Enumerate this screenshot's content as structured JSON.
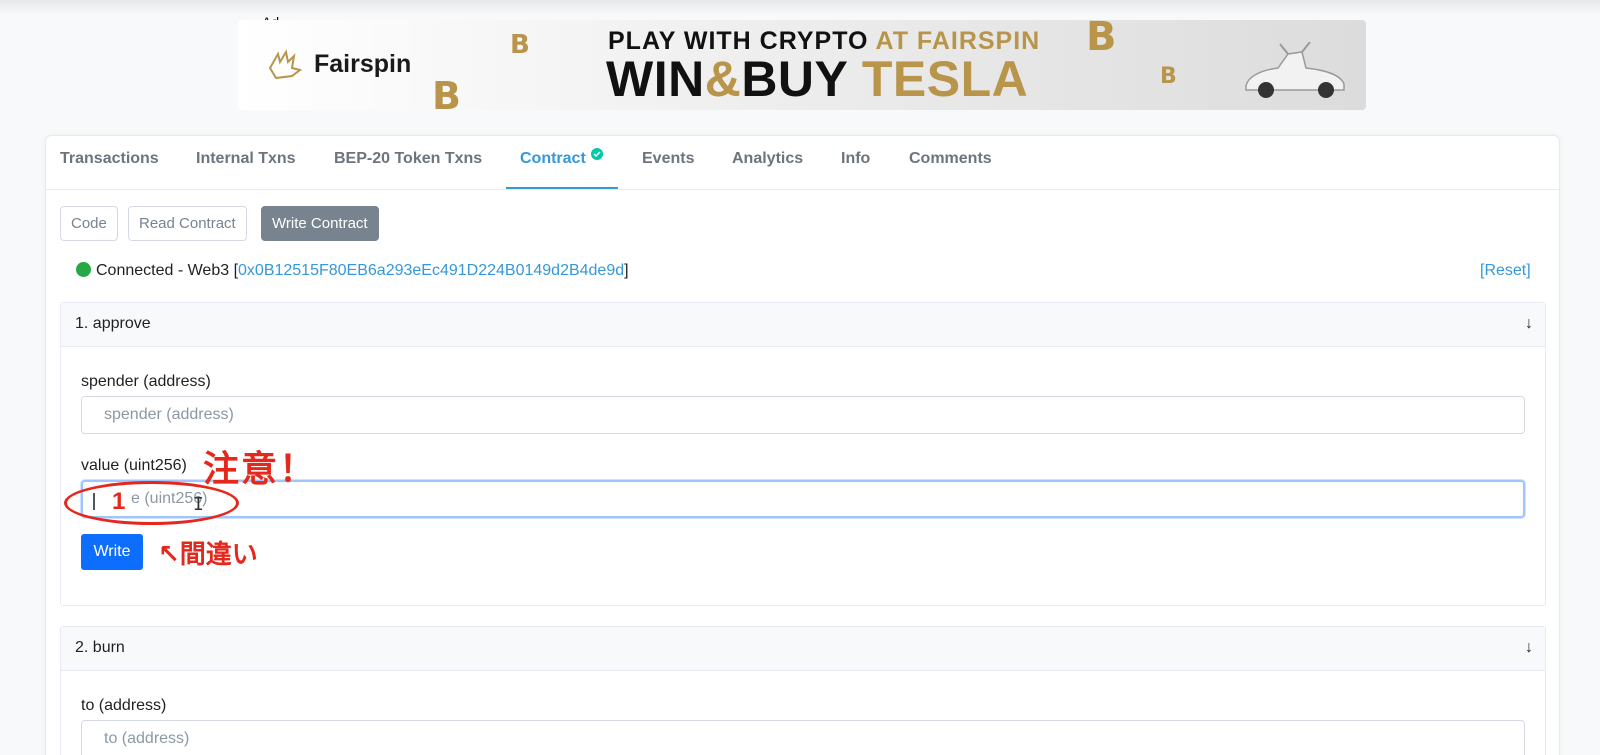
{
  "ad": {
    "tag": "Ad",
    "brand": "Fairspin",
    "headline_line1_a": "PLAY WITH CRYPTO",
    "headline_line1_b": "AT FAIRSPIN",
    "headline_line2_a": "WIN",
    "headline_line2_amp": "&",
    "headline_line2_b": "BUY",
    "headline_line2_c": "TESLA",
    "coin_symbol": "B"
  },
  "tabs": [
    {
      "label": "Transactions"
    },
    {
      "label": "Internal Txns"
    },
    {
      "label": "BEP-20 Token Txns"
    },
    {
      "label": "Contract",
      "active": true
    },
    {
      "label": "Events"
    },
    {
      "label": "Analytics"
    },
    {
      "label": "Info"
    },
    {
      "label": "Comments"
    }
  ],
  "subnav": {
    "code": "Code",
    "read": "Read Contract",
    "write": "Write Contract"
  },
  "status": {
    "text": "Connected - Web3 [",
    "address": "0x0B12515F80EB6a293eEc491D224B0149d2B4de9d",
    "close": "]",
    "reset": "[Reset]"
  },
  "functions": [
    {
      "title": "1. approve",
      "arrow": "↓",
      "fields": [
        {
          "label": "spender (address)",
          "placeholder": "spender (address)"
        },
        {
          "label": "value (uint256)",
          "placeholder": "e (uint256)"
        }
      ],
      "button": "Write"
    },
    {
      "title": "2. burn",
      "arrow": "↓",
      "fields": [
        {
          "label": "to (address)",
          "placeholder": "to (address)"
        }
      ]
    }
  ],
  "annotations": {
    "note": "注意！",
    "wrong": "↖間違い",
    "one": "1",
    "color": "#e5281d"
  },
  "colors": {
    "accent": "#3498db",
    "write_button": "#0d6efd",
    "connected": "#28a745"
  }
}
